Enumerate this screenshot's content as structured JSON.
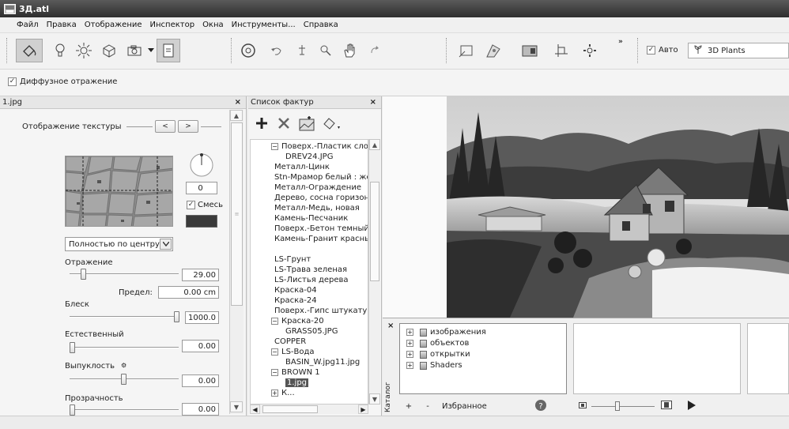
{
  "window": {
    "title": "3Д.atl"
  },
  "menu": [
    "Файл",
    "Правка",
    "Отображение",
    "Инспектор",
    "Окна",
    "Инструменты...",
    "Справка"
  ],
  "toolbar": {
    "more": "»",
    "auto_label": "Авто",
    "auto_checked": true,
    "library_value": "3D Plants",
    "icons": [
      "paint-bucket-icon",
      "light-bulb-icon",
      "sun-icon",
      "cube-icon",
      "camera-icon",
      "dropdown-arrow-icon",
      "panel-icon",
      "orbit-icon",
      "undo-icon",
      "rotate-icon",
      "zoom-icon",
      "pan-hand-icon",
      "redo-icon",
      "frame-icon",
      "render-icon",
      "photo-icon",
      "crosshair-icon",
      "settings-gear-icon"
    ]
  },
  "options": {
    "diffuse_label": "Диффузное отражение",
    "diffuse_checked": true
  },
  "left_panel": {
    "title": "1.jpg",
    "close": "×",
    "texture_mapping_label": "Отображение текстуры",
    "prev": "<",
    "next": ">",
    "rotation_value": "0",
    "mix_label": "Смесь",
    "mix_checked": true,
    "mapping_mode": "Полностью по центру",
    "reflection_label": "Отражение",
    "reflection_value": "29.00",
    "limit_label": "Предел:",
    "limit_value": "0.00 cm",
    "gloss_label": "Блеск",
    "gloss_value": "1000.0",
    "natural_label": "Естественный",
    "natural_value": "0.00",
    "bump_label": "Выпуклость",
    "bump_value": "0.00",
    "transparency_label": "Прозрачность",
    "transparency_value": "0.00",
    "mix_color": "#3a3a3a"
  },
  "texture_list": {
    "title": "Список фактур",
    "close": "×",
    "items": [
      {
        "text": "Поверх.-Пластик слоистый",
        "level": 0,
        "expander": "−"
      },
      {
        "text": "DREV24.JPG",
        "level": 2
      },
      {
        "text": "Металл-Цинк",
        "level": 1
      },
      {
        "text": "Stn-Мрамор белый : желтый",
        "level": 1
      },
      {
        "text": "Металл-Ограждение",
        "level": 1
      },
      {
        "text": "Дерево, сосна горизонтальная",
        "level": 1
      },
      {
        "text": "Металл-Медь, новая",
        "level": 1
      },
      {
        "text": "Камень-Песчаник",
        "level": 1
      },
      {
        "text": "Поверх.-Бетон темный",
        "level": 1
      },
      {
        "text": "Камень-Гранит красный",
        "level": 1
      },
      {
        "text": "",
        "level": 1
      },
      {
        "text": "LS-Грунт",
        "level": 1
      },
      {
        "text": "LS-Трава зеленая",
        "level": 1
      },
      {
        "text": "LS-Листья дерева",
        "level": 1
      },
      {
        "text": "Краска-04",
        "level": 1
      },
      {
        "text": "Краска-24",
        "level": 1
      },
      {
        "text": "Поверх.-Гипс штукатурка",
        "level": 1
      },
      {
        "text": "Краска-20",
        "level": 0,
        "expander": "−"
      },
      {
        "text": "GRASS05.JPG",
        "level": 2
      },
      {
        "text": "COPPER",
        "level": 1
      },
      {
        "text": "LS-Вода",
        "level": 0,
        "expander": "−"
      },
      {
        "text": "BASIN_W.jpg11.jpg",
        "level": 2
      },
      {
        "text": "BROWN 1",
        "level": 0,
        "expander": "−"
      },
      {
        "text": "1.jpg",
        "level": 2,
        "selected": true
      },
      {
        "text": "К...",
        "level": 0,
        "expander": "+"
      }
    ]
  },
  "catalog": {
    "side_label": "Каталог",
    "close": "×",
    "folders": [
      "изображения",
      "объектов",
      "открытки",
      "Shaders"
    ],
    "favorites_label": "Избранное",
    "add": "+",
    "remove": "-"
  }
}
